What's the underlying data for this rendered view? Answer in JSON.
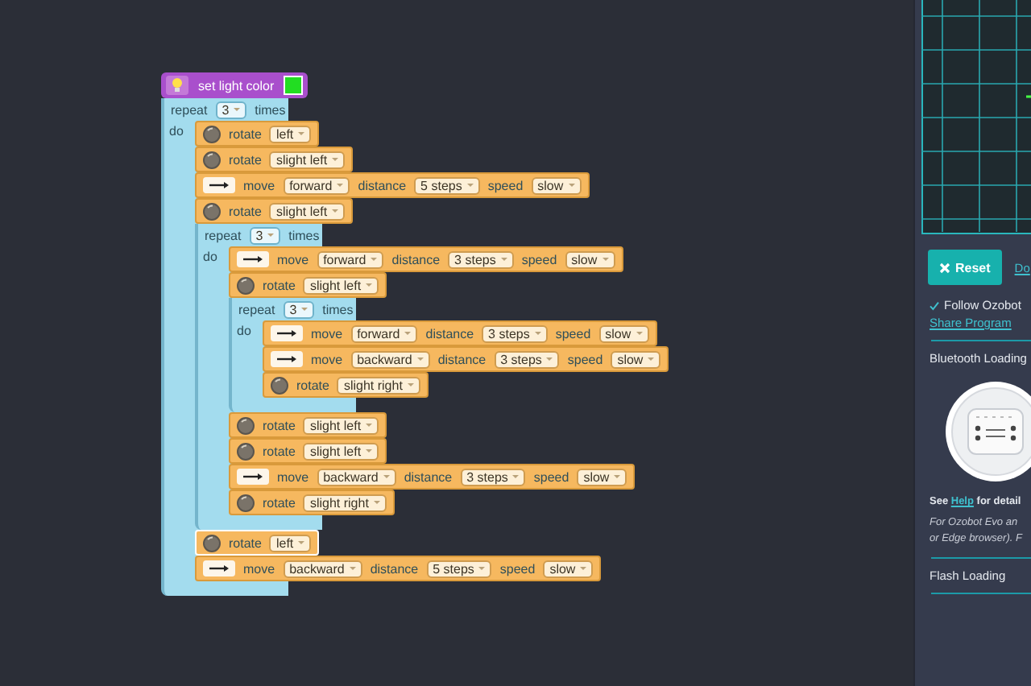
{
  "workspace": {
    "blocks": [
      {
        "kind": "light",
        "label": "set light color",
        "color": "#22dd22"
      },
      {
        "kind": "repeat",
        "label": "repeat",
        "count": "3",
        "suffix": "times",
        "do_label": "do",
        "children": [
          {
            "kind": "rotate",
            "label": "rotate",
            "direction": "left",
            "selected": false
          },
          {
            "kind": "rotate",
            "label": "rotate",
            "direction": "slight left",
            "selected": false
          },
          {
            "kind": "move",
            "label": "move",
            "direction": "forward",
            "distance_label": "distance",
            "distance": "5 steps",
            "speed_label": "speed",
            "speed": "slow",
            "selected": false
          },
          {
            "kind": "rotate",
            "label": "rotate",
            "direction": "slight left",
            "selected": false
          },
          {
            "kind": "repeat",
            "label": "repeat",
            "count": "3",
            "suffix": "times",
            "do_label": "do",
            "children": [
              {
                "kind": "move",
                "label": "move",
                "direction": "forward",
                "distance_label": "distance",
                "distance": "3 steps",
                "speed_label": "speed",
                "speed": "slow",
                "selected": false
              },
              {
                "kind": "rotate",
                "label": "rotate",
                "direction": "slight left",
                "selected": false
              },
              {
                "kind": "repeat",
                "label": "repeat",
                "count": "3",
                "suffix": "times",
                "do_label": "do",
                "children": [
                  {
                    "kind": "move",
                    "label": "move",
                    "direction": "forward",
                    "distance_label": "distance",
                    "distance": "3 steps",
                    "speed_label": "speed",
                    "speed": "slow",
                    "selected": false
                  },
                  {
                    "kind": "move",
                    "label": "move",
                    "direction": "backward",
                    "distance_label": "distance",
                    "distance": "3 steps",
                    "speed_label": "speed",
                    "speed": "slow",
                    "selected": false
                  },
                  {
                    "kind": "rotate",
                    "label": "rotate",
                    "direction": "slight right",
                    "selected": false
                  }
                ]
              },
              {
                "kind": "rotate",
                "label": "rotate",
                "direction": "slight left",
                "selected": false
              },
              {
                "kind": "rotate",
                "label": "rotate",
                "direction": "slight left",
                "selected": false
              },
              {
                "kind": "move",
                "label": "move",
                "direction": "backward",
                "distance_label": "distance",
                "distance": "3 steps",
                "speed_label": "speed",
                "speed": "slow",
                "selected": false
              },
              {
                "kind": "rotate",
                "label": "rotate",
                "direction": "slight right",
                "selected": false
              }
            ]
          },
          {
            "kind": "rotate",
            "label": "rotate",
            "direction": "left",
            "selected": true
          },
          {
            "kind": "move",
            "label": "move",
            "direction": "backward",
            "distance_label": "distance",
            "distance": "5 steps",
            "speed_label": "speed",
            "speed": "slow",
            "selected": false
          }
        ]
      }
    ]
  },
  "panel": {
    "reset_button": "Reset",
    "download_link": "Do",
    "follow": {
      "label": "Follow Ozobot",
      "checked": true
    },
    "share_link": "Share Program",
    "bluetooth_heading": "Bluetooth Loading",
    "help": {
      "before": "See",
      "link": "Help",
      "after": "for detail"
    },
    "note_lines": [
      "For Ozobot Evo an",
      "or Edge browser). F"
    ],
    "flash_heading": "Flash Loading"
  }
}
